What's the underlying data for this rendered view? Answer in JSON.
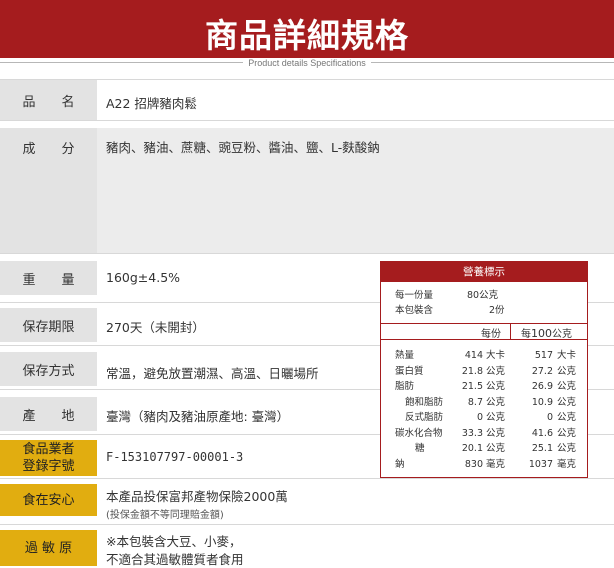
{
  "header": {
    "title": "商品詳細規格",
    "subtitle": "Product details Specifications"
  },
  "specs": {
    "name": {
      "label": "品　　名",
      "value": "A22 招牌豬肉鬆"
    },
    "ingredients": {
      "label": "成　　分",
      "value": "豬肉、豬油、蔗糖、豌豆粉、醬油、鹽、L-麩酸鈉"
    },
    "weight": {
      "label": "重　　量",
      "value": "160g±4.5%"
    },
    "shelf_life": {
      "label": "保存期限",
      "value": "270天（未開封）"
    },
    "storage": {
      "label": "保存方式",
      "value": "常溫，避免放置潮濕、高溫、日曬場所"
    },
    "origin": {
      "label": "產　　地",
      "value": "臺灣（豬肉及豬油原產地: 臺灣）"
    },
    "registration": {
      "label_line1": "食品業者",
      "label_line2": "登錄字號",
      "value": "F-153107797-00001-3"
    },
    "insurance": {
      "label": "食在安心",
      "value": "本產品投保富邦產物保險2000萬",
      "note": "(投保金額不等同理賠金額)"
    },
    "allergen": {
      "label": "過 敏 原",
      "line1": "※本包裝含大豆、小麥，",
      "line2": "不適合其過敏體質者食用"
    }
  },
  "nutrition": {
    "title": "營養標示",
    "serving_size_label": "每一份量",
    "serving_size_value": "80公克",
    "servings_label": "本包裝含",
    "servings_value": "2份",
    "col_per_serving": "每份",
    "col_per_100_prefix": "每",
    "col_per_100_num": "100",
    "col_per_100_suffix": "公克",
    "rows": [
      {
        "name": "熱量",
        "per_serving": "414",
        "unit1": "大卡",
        "per_100": "517",
        "unit2": "大卡"
      },
      {
        "name": "蛋白質",
        "per_serving": "21.8",
        "unit1": "公克",
        "per_100": "27.2",
        "unit2": "公克"
      },
      {
        "name": "脂肪",
        "per_serving": "21.5",
        "unit1": "公克",
        "per_100": "26.9",
        "unit2": "公克"
      },
      {
        "name": "飽和脂肪",
        "per_serving": "8.7",
        "unit1": "公克",
        "per_100": "10.9",
        "unit2": "公克"
      },
      {
        "name": "反式脂肪",
        "per_serving": "0",
        "unit1": "公克",
        "per_100": "0",
        "unit2": "公克"
      },
      {
        "name": "碳水化合物",
        "per_serving": "33.3",
        "unit1": "公克",
        "per_100": "41.6",
        "unit2": "公克"
      },
      {
        "name": "糖",
        "per_serving": "20.1",
        "unit1": "公克",
        "per_100": "25.1",
        "unit2": "公克"
      },
      {
        "name": "鈉",
        "per_serving": "830",
        "unit1": "毫克",
        "per_100": "1037",
        "unit2": "毫克"
      }
    ]
  },
  "colors": {
    "brand_red": "#a51c1e",
    "label_grey": "#e3e3e3",
    "label_gold": "#e1ad10",
    "panel_grey": "#ececec"
  }
}
